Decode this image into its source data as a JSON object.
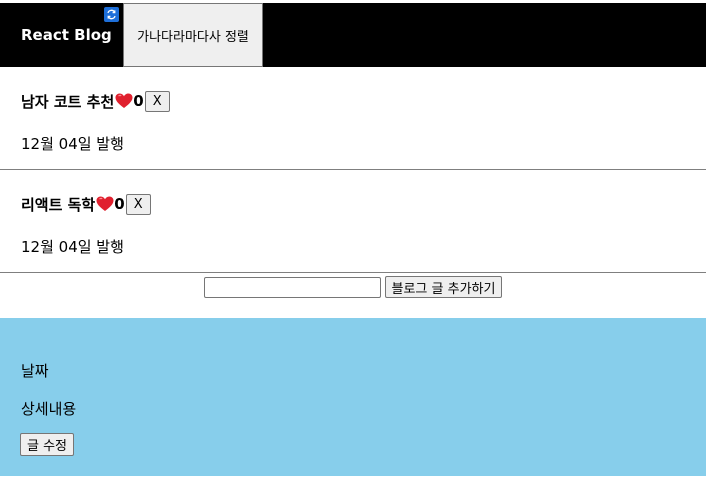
{
  "nav": {
    "brand": "React Blog",
    "sort_label": "가나다라마다사 정렬",
    "sync_icon": "sync-icon",
    "background": "#000000"
  },
  "posts": [
    {
      "title": "남자 코트 추천",
      "likes": "0",
      "delete_label": "X",
      "date": "12월 04일 발행"
    },
    {
      "title": "리액트 독학",
      "likes": "0",
      "delete_label": "X",
      "date": "12월 04일 발행"
    }
  ],
  "add_form": {
    "input_value": "",
    "button_label": "블로그 글 추가하기"
  },
  "modal": {
    "date_label": "날짜",
    "detail_label": "상세내용",
    "edit_label": "글 수정",
    "background": "#87ceeb"
  },
  "icons": {
    "like": "heart-icon"
  }
}
